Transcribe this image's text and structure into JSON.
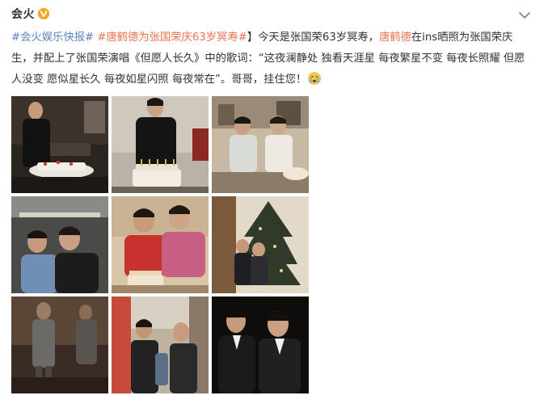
{
  "post": {
    "username": "会火",
    "verified_icon": "verified-v-badge",
    "menu_icon": "chevron-down-icon",
    "segments": [
      {
        "text": "#会火娱乐快报#",
        "type": "topic"
      },
      {
        "text": " ",
        "type": "plain"
      },
      {
        "text": "#唐鹤德为张国荣庆63岁冥寿#",
        "type": "topic_hl"
      },
      {
        "text": "】今天是张国荣63岁冥寿，",
        "type": "plain"
      },
      {
        "text": "唐鹤德",
        "type": "mention"
      },
      {
        "text": "在ins晒照为张国荣庆生，并配上了张国荣演唱《但愿人长久》中的歌词：“这夜澜静处 独看天涯星 每夜繁星不变 每夜长照耀 但愿人没变 愿似星长久 每夜如星闪照 每夜常在”。哥哥，挂住您！",
        "type": "plain"
      }
    ],
    "emoji": "crying-face-emoji",
    "photos": [
      {
        "desc": "birthday-cake-photo-1"
      },
      {
        "desc": "birthday-cake-photo-2"
      },
      {
        "desc": "two-men-seated-photo"
      },
      {
        "desc": "two-men-selfie-photo"
      },
      {
        "desc": "two-men-cake-photo"
      },
      {
        "desc": "christmas-tree-photo"
      },
      {
        "desc": "stage-photo"
      },
      {
        "desc": "street-photo"
      },
      {
        "desc": "suits-photo"
      }
    ]
  }
}
